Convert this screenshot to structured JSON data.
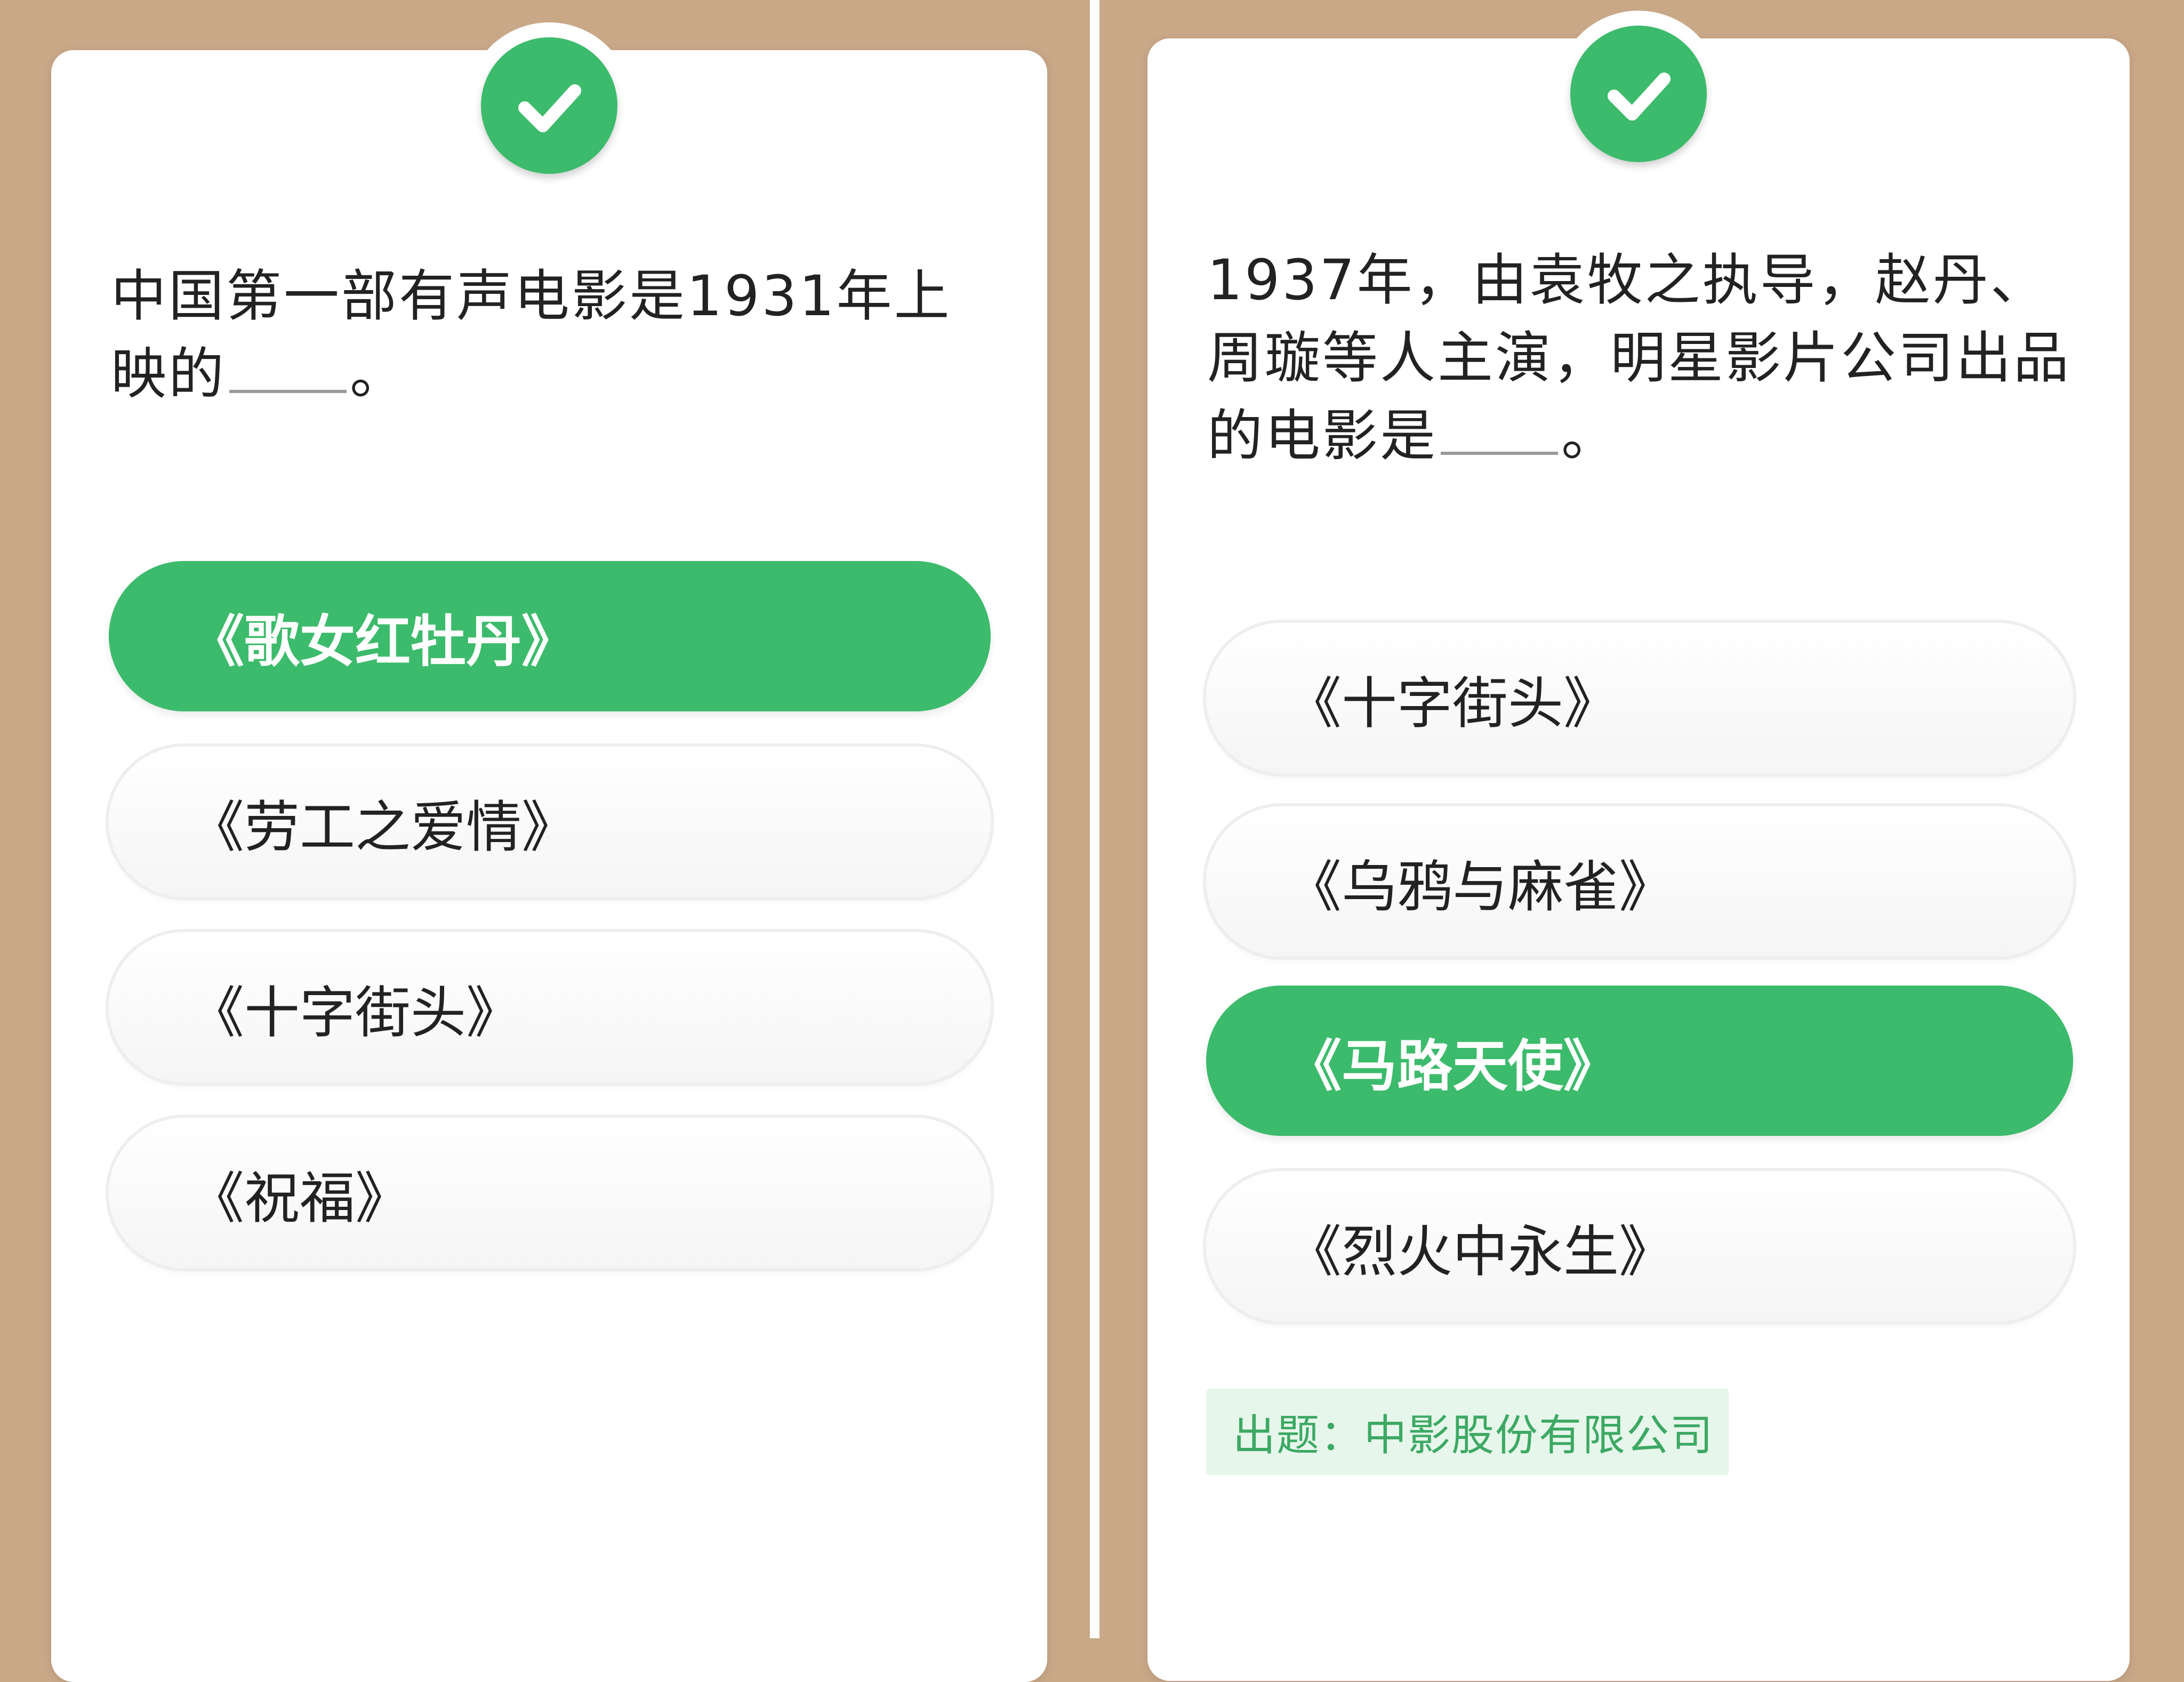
{
  "colors": {
    "accent_green": "#3dbb6c",
    "background_tan": "#c9a888",
    "source_tag_bg": "#e6f6ea",
    "source_tag_text": "#3da864"
  },
  "left_card": {
    "status_icon": "check-icon",
    "question_before_blank": "中国第一部有声电影是1931年上映的",
    "question_after_blank": "。",
    "options": [
      {
        "label": "《歌女红牡丹》",
        "selected": true
      },
      {
        "label": "《劳工之爱情》",
        "selected": false
      },
      {
        "label": "《十字街头》",
        "selected": false
      },
      {
        "label": "《祝福》",
        "selected": false
      }
    ]
  },
  "right_card": {
    "status_icon": "check-icon",
    "question_before_blank": "1937年，由袁牧之执导，赵丹、周璇等人主演，明星影片公司出品的电影是",
    "question_after_blank": "。",
    "options": [
      {
        "label": "《十字街头》",
        "selected": false
      },
      {
        "label": "《乌鸦与麻雀》",
        "selected": false
      },
      {
        "label": "《马路天使》",
        "selected": true
      },
      {
        "label": "《烈火中永生》",
        "selected": false
      }
    ],
    "source_label": "出题：中影股份有限公司"
  }
}
